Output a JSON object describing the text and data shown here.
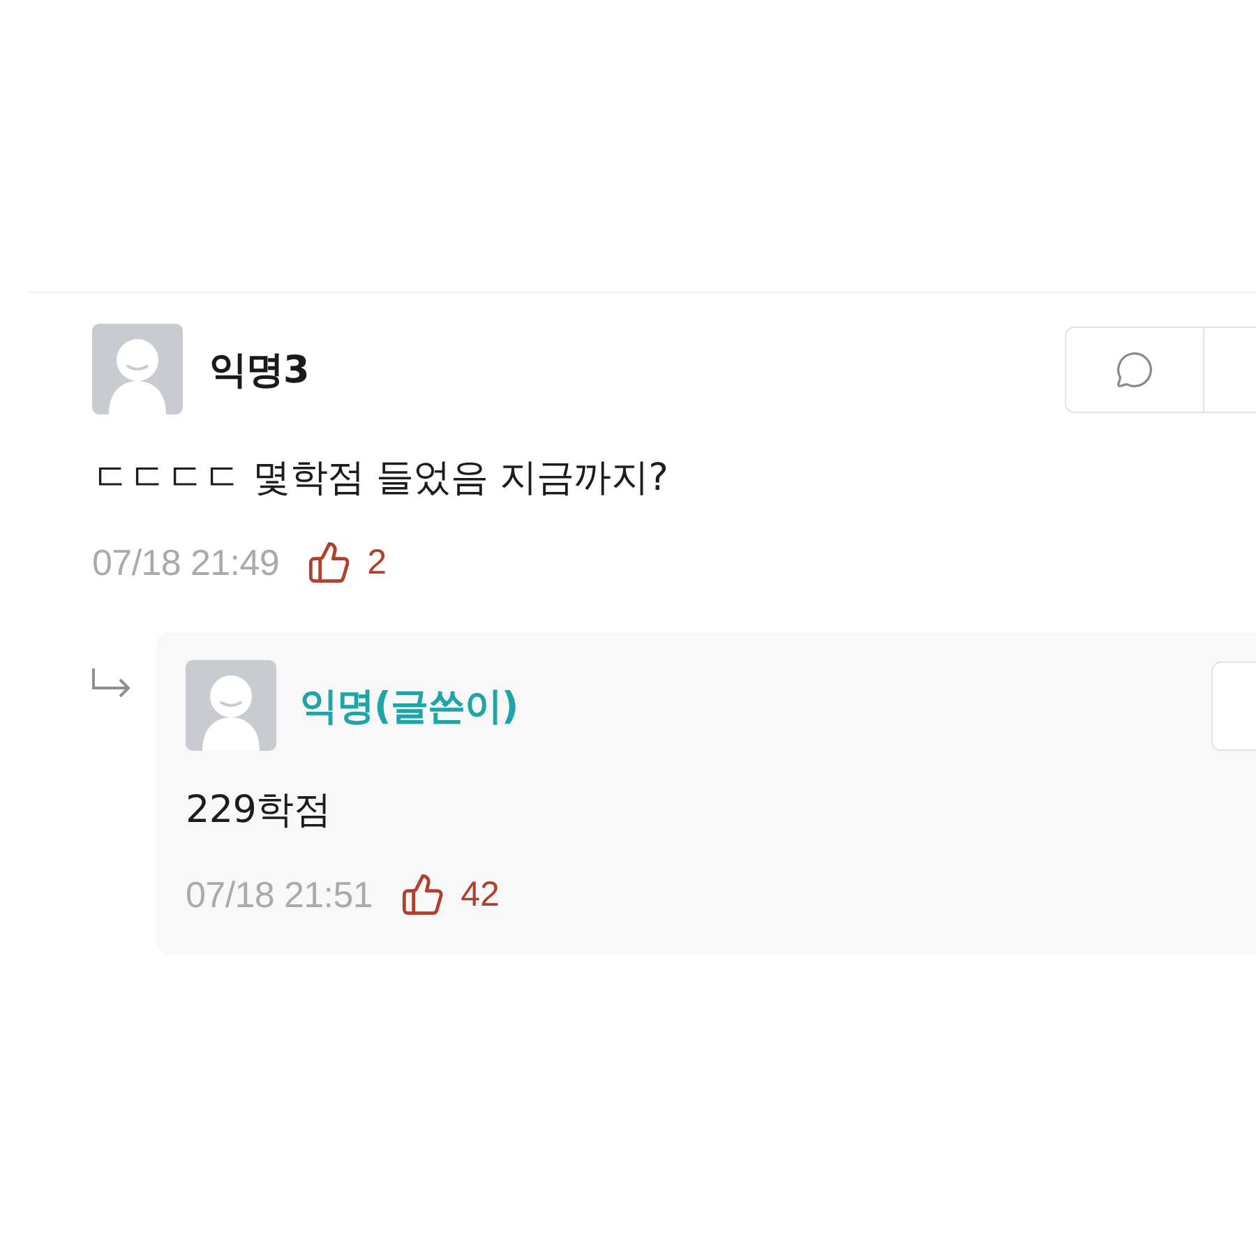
{
  "comments": [
    {
      "author": "익명3",
      "is_writer": false,
      "text": "ㄷㄷㄷㄷ 몇학점 들었음 지금까지?",
      "time": "07/18 21:49",
      "likes": "2",
      "replies": [
        {
          "author": "익명(글쓴이)",
          "is_writer": true,
          "text": "229학점",
          "time": "07/18 21:51",
          "likes": "42"
        }
      ]
    }
  ]
}
